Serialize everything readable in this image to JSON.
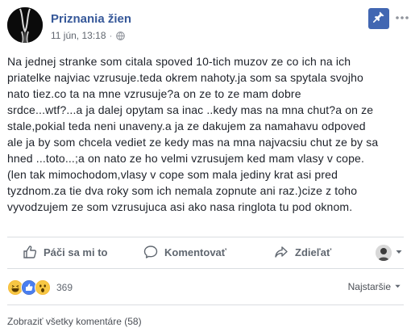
{
  "header": {
    "page_name": "Priznania žien",
    "date": "11 jún, 13:18",
    "separator": "·",
    "audience_icon": "globe-icon",
    "pin_icon": "pin-icon",
    "more_icon": "more-dots-icon"
  },
  "post": {
    "lines": [
      "Na jednej stranke som citala spoved 10-tich muzov ze co ich na ich",
      "priatelke najviac vzrusuje.teda okrem nahoty.ja som sa spytala svojho",
      "nato tiez.co ta na mne vzrusuje?a on ze to ze mam dobre",
      "srdce...wtf?...a ja dalej opytam sa inac ..kedy mas na mna chut?a on ze",
      "stale,pokial teda neni unaveny.a ja ze dakujem za namahavu odpoved",
      "ale ja by som chcela vediet ze kedy mas na mna najvacsiu chut ze by sa",
      "hned ...toto...;a on nato ze ho velmi vzrusujem ked mam vlasy v cope.",
      "(len tak mimochodom,vlasy v cope som mala jediny krat asi pred",
      "tyzdnom.za tie dva roky som ich nemala zopnute ani raz.)cize z toho",
      "vyvodzujem ze som vzrusujuca asi ako nasa ringlota tu pod oknom."
    ]
  },
  "actions": {
    "like_label": "Páči sa mi to",
    "comment_label": "Komentovať",
    "share_label": "Zdieľať"
  },
  "reactions": {
    "count": "369",
    "types": [
      "haha",
      "like",
      "wow"
    ],
    "sort_label": "Najstaršie"
  },
  "comments": {
    "view_all_label": "Zobraziť všetky komentáre (58)"
  },
  "colors": {
    "link": "#365899",
    "pin_bg": "#4267b2",
    "text": "#1d2129",
    "muted": "#616770"
  }
}
